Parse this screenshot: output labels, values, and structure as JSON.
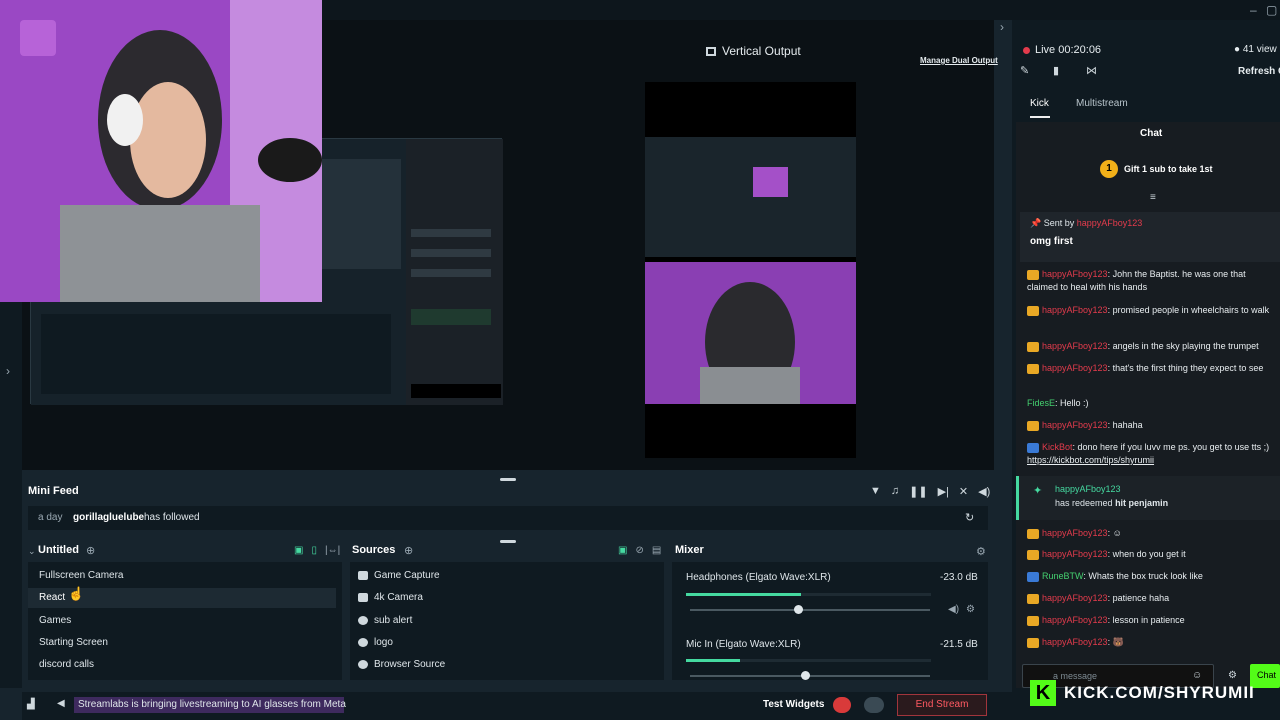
{
  "editor": {
    "vertical_output_label": "Vertical Output",
    "manage_dual_output": "Manage Dual Output"
  },
  "stream": {
    "live_label": "Live 00:20:06",
    "viewers": "41 view",
    "refresh_label": "Refresh C"
  },
  "chat_tabs": [
    "Kick",
    "Multistream"
  ],
  "chat": {
    "title": "Chat",
    "gift_count": "1",
    "gift_label": "Gift 1 sub to take 1st",
    "pinned_sent_by_prefix": "Sent by",
    "pinned_sender": "happyAFboy123",
    "pinned_message": "omg first",
    "messages": [
      {
        "user": "happyAFboy123",
        "text": ": John the Baptist. he was one that claimed to heal with his hands"
      },
      {
        "user": "happyAFboy123",
        "text": ": promised people in wheelchairs to walk"
      },
      {
        "user": "happyAFboy123",
        "text": ": angels in the sky playing the trumpet"
      },
      {
        "user": "happyAFboy123",
        "text": ": that's the first thing they expect to see"
      },
      {
        "user": "FidesE",
        "text": ": Hello :)"
      },
      {
        "user": "happyAFboy123",
        "text": ": hahaha"
      },
      {
        "user": "KickBot",
        "text": ": dono here if you luvv me ps. you get to use tts ;) ",
        "link": "https://kickbot.com/tips/shyrumii"
      },
      {
        "user": "happyAFboy123",
        "text": ": when do you get it"
      },
      {
        "user": "RuneBTW",
        "text": ": Whats the box truck look like"
      },
      {
        "user": "happyAFboy123",
        "text": ": patience haha"
      },
      {
        "user": "happyAFboy123",
        "text": ": lesson in patience"
      }
    ],
    "redeem_user": "happyAFboy123",
    "redeem_text_prefix": "has redeemed",
    "redeem_item": "hit penjamin",
    "input_placeholder": "a message",
    "send_label": "Chat",
    "brand_url": "KICK.COM/SHYRUMII",
    "brand_k": "K"
  },
  "mini_feed": {
    "title": "Mini Feed",
    "time": "a day",
    "user": "gorillagluelube",
    "action": "has followed"
  },
  "scenes": {
    "title": "Untitled",
    "items": [
      "Fullscreen Camera",
      "React",
      "Games",
      "Starting Screen",
      "discord calls"
    ]
  },
  "sources": {
    "title": "Sources",
    "items": [
      "Game Capture",
      "4k Camera",
      "sub alert",
      "logo",
      "Browser Source"
    ]
  },
  "mixer": {
    "title": "Mixer",
    "channels": [
      {
        "name": "Headphones (Elgato Wave:XLR)",
        "db": "-23.0 dB",
        "level": 0.47,
        "volume": 0.45
      },
      {
        "name": "Mic In (Elgato Wave:XLR)",
        "db": "-21.5 dB",
        "level": 0.22,
        "volume": 0.48
      }
    ]
  },
  "footer": {
    "news": "Streamlabs is bringing livestreaming to AI glasses from Meta",
    "test_widgets": "Test Widgets",
    "end_stream": "End Stream"
  },
  "colors": {
    "accent_green": "#45d9a0",
    "kick_green": "#53fc18",
    "username_red": "#e33b4c",
    "end_stream_red": "#ff5a62"
  }
}
